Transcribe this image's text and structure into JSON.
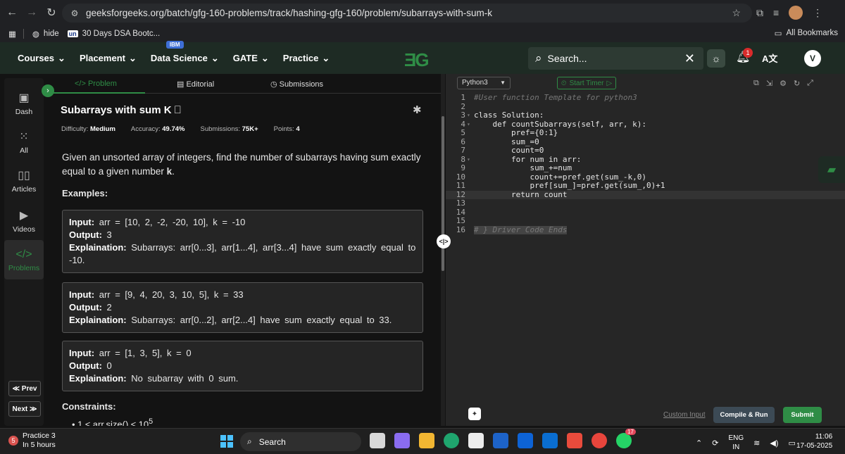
{
  "browser": {
    "url": "geeksforgeeks.org/batch/gfg-160-problems/track/hashing-gfg-160/problem/subarrays-with-sum-k",
    "bookmarks": [
      {
        "label": "hide"
      },
      {
        "label": "30 Days DSA Bootc..."
      }
    ],
    "bookmark_badge": "un",
    "all_bookmarks": "All Bookmarks"
  },
  "gfg_nav": {
    "menu": [
      "Courses",
      "Placement",
      "Data Science",
      "GATE",
      "Practice"
    ],
    "ibm_badge": "IBM",
    "logo": "ƎG",
    "search_placeholder": "Search...",
    "notification_count": "1",
    "user_initial": "V"
  },
  "sidebar": {
    "items": [
      {
        "label": "Dash",
        "icon": "dashboard-icon"
      },
      {
        "label": "All",
        "icon": "grid-icon"
      },
      {
        "label": "Articles",
        "icon": "book-icon"
      },
      {
        "label": "Videos",
        "icon": "video-icon"
      },
      {
        "label": "Problems",
        "icon": "code-icon"
      }
    ],
    "prev": "≪ Prev",
    "next": "Next ≫"
  },
  "problem": {
    "tabs": [
      "Problem",
      "Editorial",
      "Submissions"
    ],
    "title": "Subarrays with sum K",
    "meta": {
      "difficulty_label": "Difficulty:",
      "difficulty": "Medium",
      "accuracy_label": "Accuracy:",
      "accuracy": "49.74%",
      "submissions_label": "Submissions:",
      "submissions": "75K+",
      "points_label": "Points:",
      "points": "4"
    },
    "description_prefix": "Given an unsorted array of integers, find the number of subarrays having sum exactly equal to a given number ",
    "description_k": "k",
    "description_suffix": ".",
    "examples_heading": "Examples:",
    "examples": [
      {
        "input": "arr = [10, 2, -2, -20, 10], k = -10",
        "output": "3",
        "explanation": "Subarrays: arr[0...3], arr[1...4], arr[3...4] have sum exactly equal to -10."
      },
      {
        "input": "arr = [9, 4, 20, 3, 10, 5], k = 33",
        "output": "2",
        "explanation": "Subarrays: arr[0...2], arr[2...4] have sum exactly equal to 33."
      },
      {
        "input": "arr = [1, 3, 5], k = 0",
        "output": "0",
        "explanation": "No subarray with 0 sum."
      }
    ],
    "input_label": "Input:",
    "output_label": "Output:",
    "explanation_label": "Explaination:",
    "constraints_heading": "Constraints:",
    "constraint_partial": "1 ≤ arr.size() ≤ 10",
    "constraint_exp": "5"
  },
  "editor": {
    "language": "Python3",
    "timer": "Start Timer",
    "lines": [
      {
        "n": "1",
        "text": "#User function Template for python3"
      },
      {
        "n": "2",
        "text": ""
      },
      {
        "n": "3",
        "text": "class Solution:"
      },
      {
        "n": "4",
        "text": "    def countSubarrays(self, arr, k):"
      },
      {
        "n": "5",
        "text": "        pref={0:1}"
      },
      {
        "n": "6",
        "text": "        sum_=0"
      },
      {
        "n": "7",
        "text": "        count=0"
      },
      {
        "n": "8",
        "text": "        for num in arr:"
      },
      {
        "n": "9",
        "text": "            sum_+=num"
      },
      {
        "n": "10",
        "text": "            count+=pref.get(sum_-k,0)"
      },
      {
        "n": "11",
        "text": "            pref[sum_]=pref.get(sum_,0)+1"
      },
      {
        "n": "12",
        "text": "        return count"
      },
      {
        "n": "13",
        "text": ""
      },
      {
        "n": "14",
        "text": ""
      },
      {
        "n": "15",
        "text": ""
      },
      {
        "n": "16",
        "text": "# } Driver Code Ends"
      }
    ],
    "custom_input": "Custom Input",
    "compile_run": "Compile & Run",
    "submit": "Submit"
  },
  "taskbar": {
    "notif_count": "5",
    "notif_title": "Practice 3",
    "notif_sub": "In 5 hours",
    "search": "Search",
    "lang_top": "ENG",
    "lang_bottom": "IN",
    "time": "11:06",
    "date": "17-05-2025",
    "whatsapp_badge": "17"
  }
}
